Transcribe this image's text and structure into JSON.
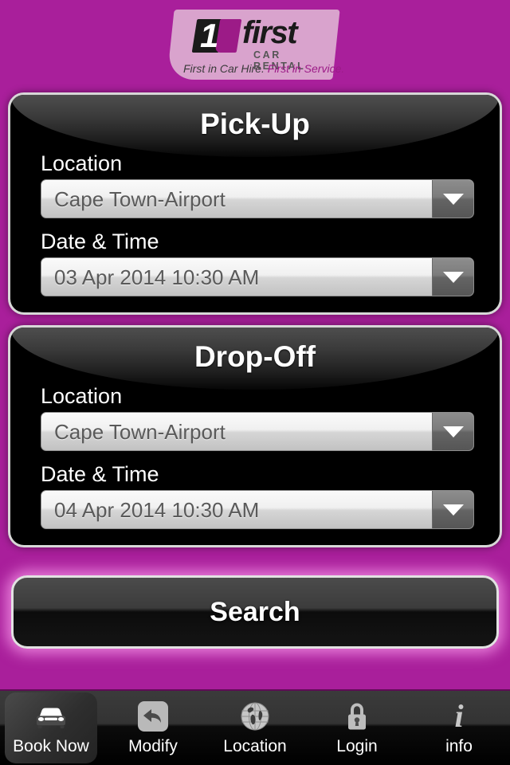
{
  "brand": {
    "numeral": "1",
    "wordmark": "first",
    "subtitle": "CAR RENTAL",
    "tagline_dark": "First in Car Hire.",
    "tagline_accent": "First in Service.",
    "accent_color": "#9c1b87",
    "background_color": "#a91f9b"
  },
  "pickup": {
    "title": "Pick-Up",
    "location_label": "Location",
    "location_value": "Cape Town-Airport",
    "datetime_label": "Date & Time",
    "datetime_value": "03 Apr 2014 10:30 AM"
  },
  "dropoff": {
    "title": "Drop-Off",
    "location_label": "Location",
    "location_value": "Cape Town-Airport",
    "datetime_label": "Date & Time",
    "datetime_value": "04 Apr 2014 10:30 AM"
  },
  "actions": {
    "search_label": "Search"
  },
  "tabbar": {
    "items": [
      {
        "label": "Book Now",
        "icon": "car-icon",
        "selected": true
      },
      {
        "label": "Modify",
        "icon": "back-arrow-icon",
        "selected": false
      },
      {
        "label": "Location",
        "icon": "globe-icon",
        "selected": false
      },
      {
        "label": "Login",
        "icon": "lock-icon",
        "selected": false
      },
      {
        "label": "info",
        "icon": "info-icon",
        "selected": false
      }
    ]
  }
}
